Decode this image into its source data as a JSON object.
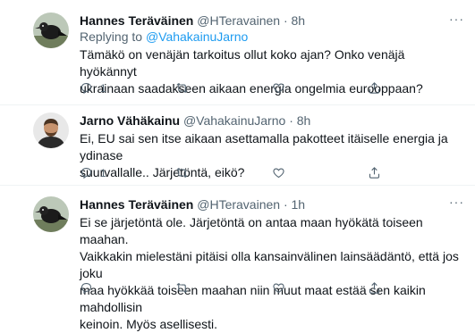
{
  "tweets": [
    {
      "name": "Hannes Teräväinen",
      "handle": "@HTeravainen",
      "separator": "·",
      "time": "8h",
      "replying_prefix": "Replying to ",
      "replying_to": "@VahakainuJarno",
      "text": "Tämäkö on venäjän tarkoitus ollut koko ajan? Onko venäjä hyökännyt\nukrainaan saadakseen aikaan energia ongelmia eurooppaan?",
      "reply_count": "1",
      "more_label": "···"
    },
    {
      "name": "Jarno Vähäkainu",
      "handle": "@VahakainuJarno",
      "separator": "·",
      "time": "8h",
      "text": "Ei, EU sai sen itse aikaan asettamalla pakotteet itäiselle energia ja ydinase\nsuurvallalle.. Järjetöntä, eikö?",
      "reply_count": "1"
    },
    {
      "name": "Hannes Teräväinen",
      "handle": "@HTeravainen",
      "separator": "·",
      "time": "1h",
      "text": "Ei se järjetöntä ole. Järjetöntä on antaa maan hyökätä toiseen maahan.\nVaikkakin mielestäni pitäisi olla kansainvälinen lainsäädäntö, että jos joku\nmaa hyökkää toiseen maahan niin muut maat estää sen kaikin mahdollisin\nkeinoin. Myös asellisesti.",
      "reply_count": "",
      "more_label": "···"
    }
  ],
  "icons": {
    "reply": "reply-icon",
    "retweet": "retweet-icon",
    "like": "heart-icon",
    "share": "share-icon",
    "more": "more-icon"
  },
  "colors": {
    "text": "#0f1419",
    "secondary": "#536471",
    "link": "#1d9bf0",
    "divider": "#eff3f4"
  }
}
